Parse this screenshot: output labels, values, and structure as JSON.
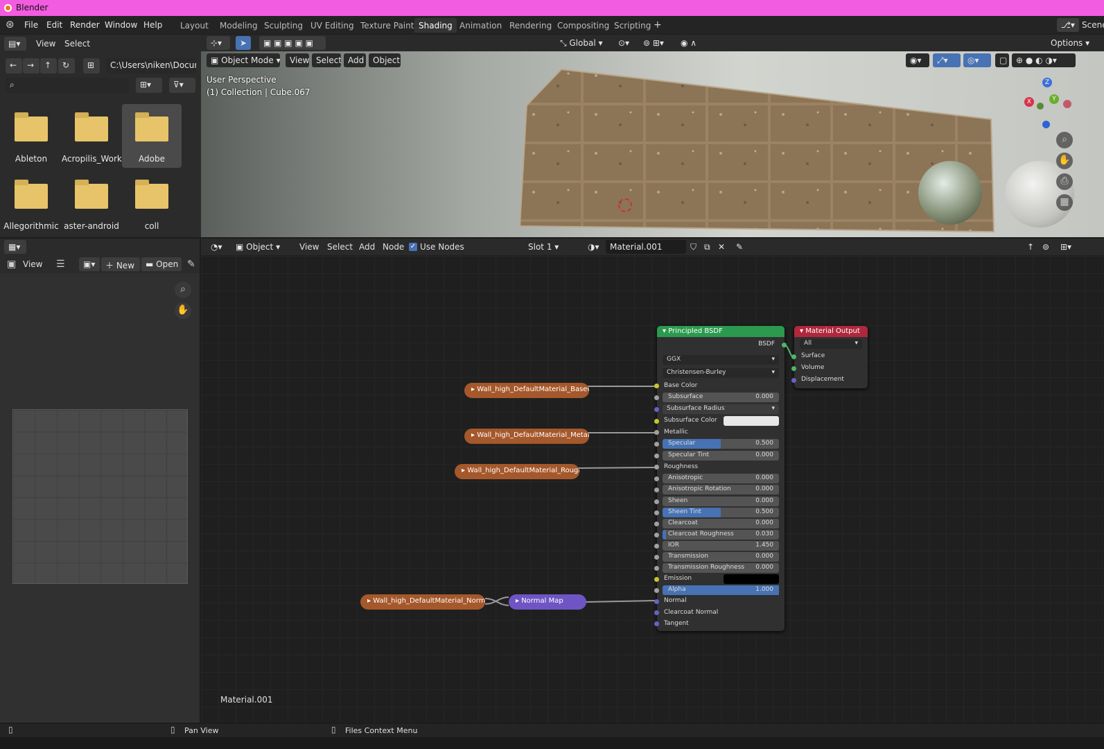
{
  "app": {
    "title": "Blender"
  },
  "menu": {
    "file": "File",
    "edit": "Edit",
    "render": "Render",
    "window": "Window",
    "help": "Help"
  },
  "workspaces": [
    "Layout",
    "Modeling",
    "Sculpting",
    "UV Editing",
    "Texture Paint",
    "Shading",
    "Animation",
    "Rendering",
    "Compositing",
    "Scripting"
  ],
  "active_workspace": "Shading",
  "scene": {
    "label": "Scene"
  },
  "file_browser": {
    "view": "View",
    "select": "Select",
    "path": "C:\\Users\\niken\\Docum...",
    "folders": [
      "Ableton",
      "Acropilis_Work",
      "Adobe",
      "Allegorithmic",
      "aster-android",
      "coll"
    ],
    "selected_folder": "Adobe"
  },
  "image_editor": {
    "view": "View",
    "new": "New",
    "open": "Open"
  },
  "viewport": {
    "mode": "Object Mode",
    "view": "View",
    "select": "Select",
    "add": "Add",
    "object": "Object",
    "orientation": "Global",
    "options": "Options",
    "info_line1": "User Perspective",
    "info_line2": "(1) Collection | Cube.067",
    "gizmo": {
      "x": "X",
      "y": "Y",
      "z": "Z"
    }
  },
  "node_editor": {
    "object": "Object",
    "view": "View",
    "select": "Select",
    "add": "Add",
    "node": "Node",
    "use_nodes": "Use Nodes",
    "slot": "Slot 1",
    "material": "Material.001",
    "footer_material": "Material.001",
    "image_nodes": [
      "Wall_high_DefaultMaterial_BaseColor....",
      "Wall_high_DefaultMaterial_Metallic.png",
      "Wall_high_DefaultMaterial_Roughness....",
      "Wall_high_DefaultMaterial_Normal.png"
    ],
    "normal_map": "Normal Map",
    "bsdf": {
      "title": "Principled BSDF",
      "output": "BSDF",
      "distribution": "GGX",
      "subsurface_method": "Christensen-Burley",
      "base_color": "Base Color",
      "subsurface": {
        "label": "Subsurface",
        "value": "0.000"
      },
      "subsurface_radius": "Subsurface Radius",
      "subsurface_color": "Subsurface Color",
      "metallic": "Metallic",
      "specular": {
        "label": "Specular",
        "value": "0.500",
        "fill": 0.5
      },
      "specular_tint": {
        "label": "Specular Tint",
        "value": "0.000"
      },
      "roughness": "Roughness",
      "anisotropic": {
        "label": "Anisotropic",
        "value": "0.000"
      },
      "anisotropic_rotation": {
        "label": "Anisotropic Rotation",
        "value": "0.000"
      },
      "sheen": {
        "label": "Sheen",
        "value": "0.000"
      },
      "sheen_tint": {
        "label": "Sheen Tint",
        "value": "0.500",
        "fill": 0.5
      },
      "clearcoat": {
        "label": "Clearcoat",
        "value": "0.000"
      },
      "clearcoat_roughness": {
        "label": "Clearcoat Roughness",
        "value": "0.030",
        "fill": 0.03
      },
      "ior": {
        "label": "IOR",
        "value": "1.450"
      },
      "transmission": {
        "label": "Transmission",
        "value": "0.000"
      },
      "transmission_roughness": {
        "label": "Transmission Roughness",
        "value": "0.000"
      },
      "emission": "Emission",
      "alpha": {
        "label": "Alpha",
        "value": "1.000",
        "fill": 1.0
      },
      "normal": "Normal",
      "clearcoat_normal": "Clearcoat Normal",
      "tangent": "Tangent"
    },
    "material_output": {
      "title": "Material Output",
      "target": "All",
      "surface": "Surface",
      "volume": "Volume",
      "displacement": "Displacement"
    }
  },
  "status": {
    "pan": "Pan View",
    "context": "Files Context Menu"
  },
  "colors": {
    "titlebar": "#f25ce0",
    "bsdf_header": "#2b9a4f",
    "output_header": "#b0283c",
    "image_node": "#a5582b",
    "normal_map_node": "#6f55c4",
    "accent": "#4772b3"
  }
}
